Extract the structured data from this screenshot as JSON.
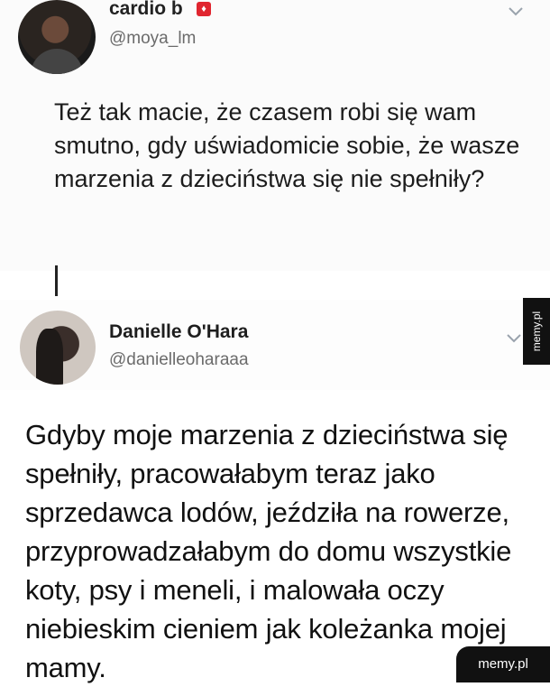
{
  "tweet1": {
    "display_name": "cardio b",
    "handle": "@moya_lm",
    "text": "Też tak macie, że czasem robi się wam smutno, gdy uświadomicie sobie, że wasze marzenia z dzieciństwa się nie spełniły?"
  },
  "tweet2": {
    "display_name": "Danielle O'Hara",
    "handle": "@danielleoharaaa",
    "text": "Gdyby moje marzenia z dzieciństwa się spełniły, pracowałabym teraz jako sprzedawca lodów, jeździła na rowerze, przyprowadzałabym do domu wszystkie koty, psy i meneli, i malowała oczy niebieskim cieniem jak koleżanka mojej mamy."
  },
  "watermarks": {
    "side": "memy.pl",
    "corner": "memy.pl"
  },
  "icons": {
    "badge": "red-badge-icon",
    "menu": "chevron-down-icon"
  },
  "colors": {
    "badge": "#e0252f",
    "watermark_bg": "#111111"
  }
}
